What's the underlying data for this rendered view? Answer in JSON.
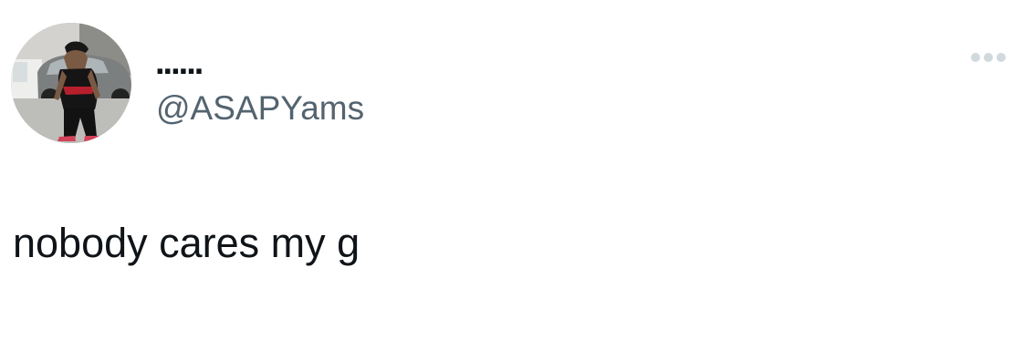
{
  "tweet": {
    "author": {
      "display_name": "......",
      "handle": "@ASAPYams",
      "avatar_icon": "profile-photo"
    },
    "more_icon": "more-horizontal-icon",
    "text": "nobody cares my g"
  },
  "colors": {
    "background": "#ffffff",
    "primary_text": "#0f1419",
    "secondary_text": "#536471",
    "more_icon": "#cfd9de"
  }
}
